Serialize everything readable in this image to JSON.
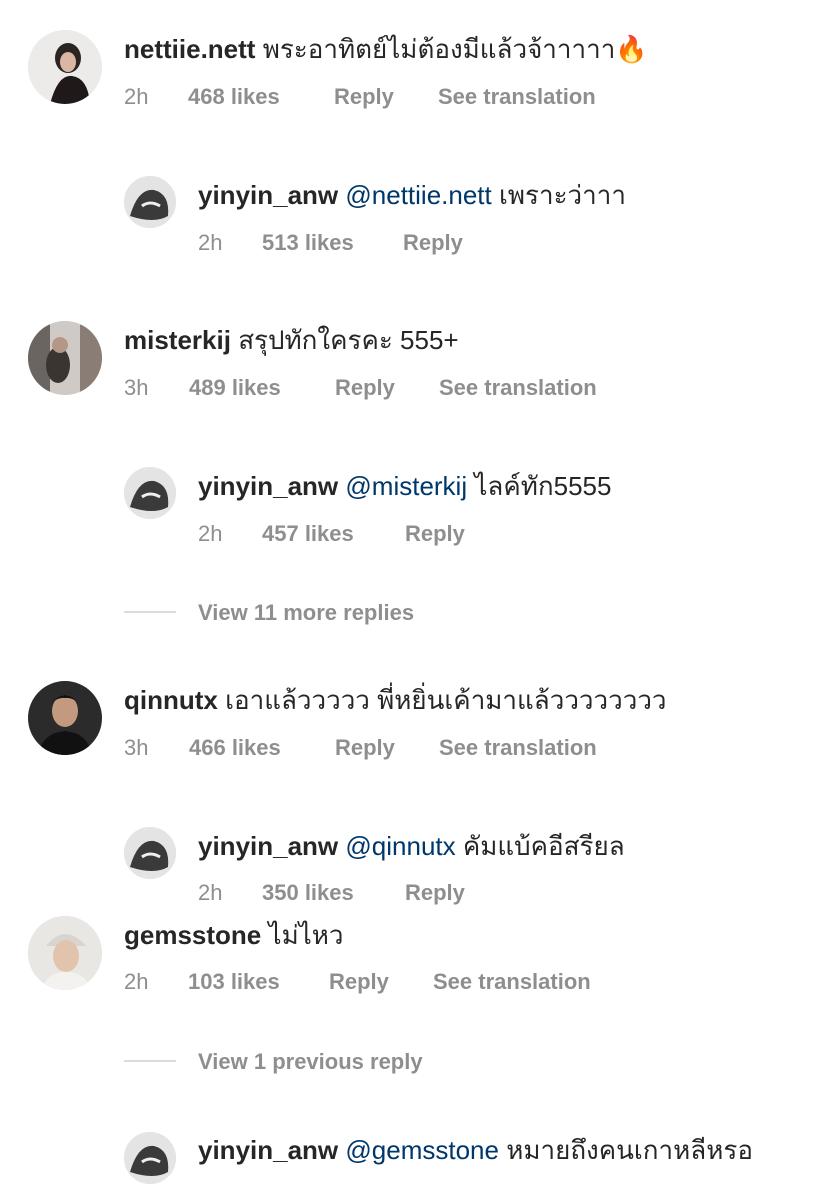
{
  "comments": [
    {
      "username": "nettiie.nett",
      "text": "พระอาทิตย์ไม่ต้องมีแล้วจ้าาาาา",
      "emoji": "🔥",
      "time": "2h",
      "likes": "468 likes",
      "reply": "Reply",
      "translate": "See translation"
    },
    {
      "username": "yinyin_anw",
      "mention": "@nettiie.nett",
      "text": "เพราะว่าาา",
      "time": "2h",
      "likes": "513 likes",
      "reply": "Reply"
    },
    {
      "username": "misterkij",
      "text": "สรุปทักใครคะ 555+",
      "time": "3h",
      "likes": "489 likes",
      "reply": "Reply",
      "translate": "See translation"
    },
    {
      "username": "yinyin_anw",
      "mention": "@misterkij",
      "text": "ไลค์ทัก5555",
      "time": "2h",
      "likes": "457 likes",
      "reply": "Reply"
    },
    {
      "username": "qinnutx",
      "text": "เอาแล้ววววว พี่หยิ่นเค้ามาแล้วววววววว",
      "time": "3h",
      "likes": "466 likes",
      "reply": "Reply",
      "translate": "See translation"
    },
    {
      "username": "yinyin_anw",
      "mention": "@qinnutx",
      "text": "คัมแบ้คอีสรียล",
      "time": "2h",
      "likes": "350 likes",
      "reply": "Reply"
    },
    {
      "username": "gemsstone",
      "text": "ไม่ไหว",
      "time": "2h",
      "likes": "103 likes",
      "reply": "Reply",
      "translate": "See translation"
    },
    {
      "username": "yinyin_anw",
      "mention": "@gemsstone",
      "text": "หมายถึงคนเกาหลีหรอ"
    }
  ],
  "view_more": [
    "View 11 more replies",
    "View 1 previous reply"
  ]
}
